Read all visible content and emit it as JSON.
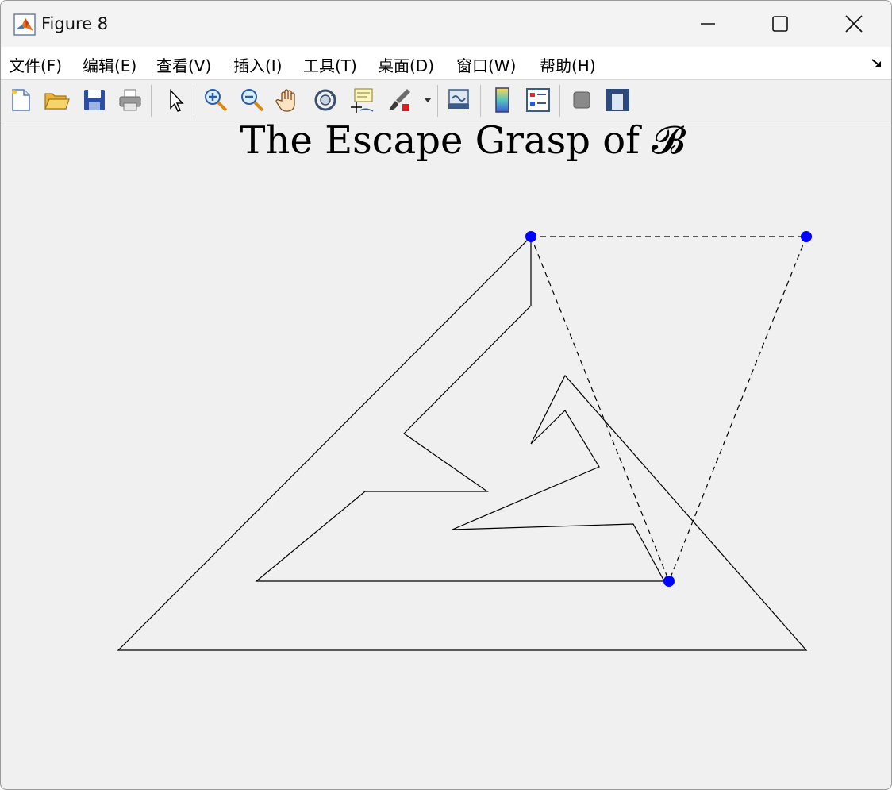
{
  "window": {
    "title": "Figure 8"
  },
  "menubar": {
    "items": [
      {
        "label": "文件(F)"
      },
      {
        "label": "编辑(E)"
      },
      {
        "label": "查看(V)"
      },
      {
        "label": "插入(I)"
      },
      {
        "label": "工具(T)"
      },
      {
        "label": "桌面(D)"
      },
      {
        "label": "窗口(W)"
      },
      {
        "label": "帮助(H)"
      }
    ]
  },
  "toolbar": {
    "icons": [
      "new-figure-icon",
      "open-file-icon",
      "save-icon",
      "print-icon",
      "edit-plot-arrow-icon",
      "zoom-in-icon",
      "zoom-out-icon",
      "pan-hand-icon",
      "rotate-3d-icon",
      "data-cursor-icon",
      "brush-icon",
      "brush-dropdown-icon",
      "link-plot-icon",
      "colorbar-icon",
      "legend-icon",
      "hide-plot-tools-icon",
      "show-plot-tools-icon"
    ]
  },
  "axes": {
    "title": "The Escape Grasp of 𝓑"
  },
  "colors": {
    "point": "#0000ff",
    "line": "#000000",
    "background": "#f0f0f0"
  }
}
